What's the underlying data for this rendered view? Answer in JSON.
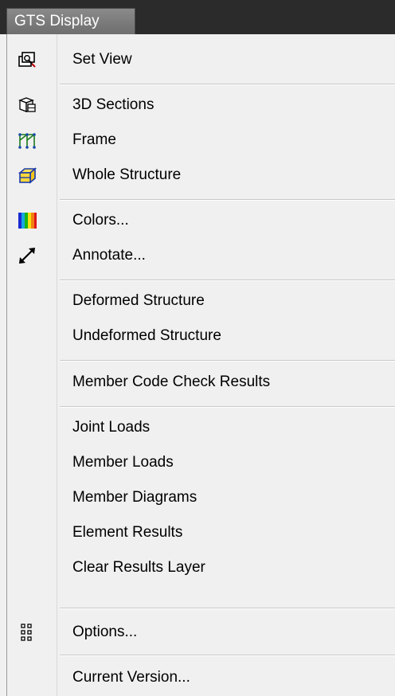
{
  "window": {
    "tab_title": "GTS Display"
  },
  "menu": {
    "set_view": "Set View",
    "sections_3d": "3D Sections",
    "frame": "Frame",
    "whole_structure": "Whole Structure",
    "colors": "Colors...",
    "annotate": "Annotate...",
    "deformed_structure": "Deformed Structure",
    "undeformed_structure": "Undeformed Structure",
    "member_code_check": "Member Code Check Results",
    "joint_loads": "Joint Loads",
    "member_loads": "Member Loads",
    "member_diagrams": "Member Diagrams",
    "element_results": "Element Results",
    "clear_results_layer": "Clear Results Layer",
    "options": "Options...",
    "current_version": "Current Version..."
  },
  "icons": {
    "set_view": "set-view-icon",
    "sections_3d": "3d-sections-icon",
    "frame": "frame-icon",
    "whole_structure": "whole-structure-icon",
    "colors": "colors-icon",
    "annotate": "annotate-icon",
    "options": "options-icon"
  }
}
